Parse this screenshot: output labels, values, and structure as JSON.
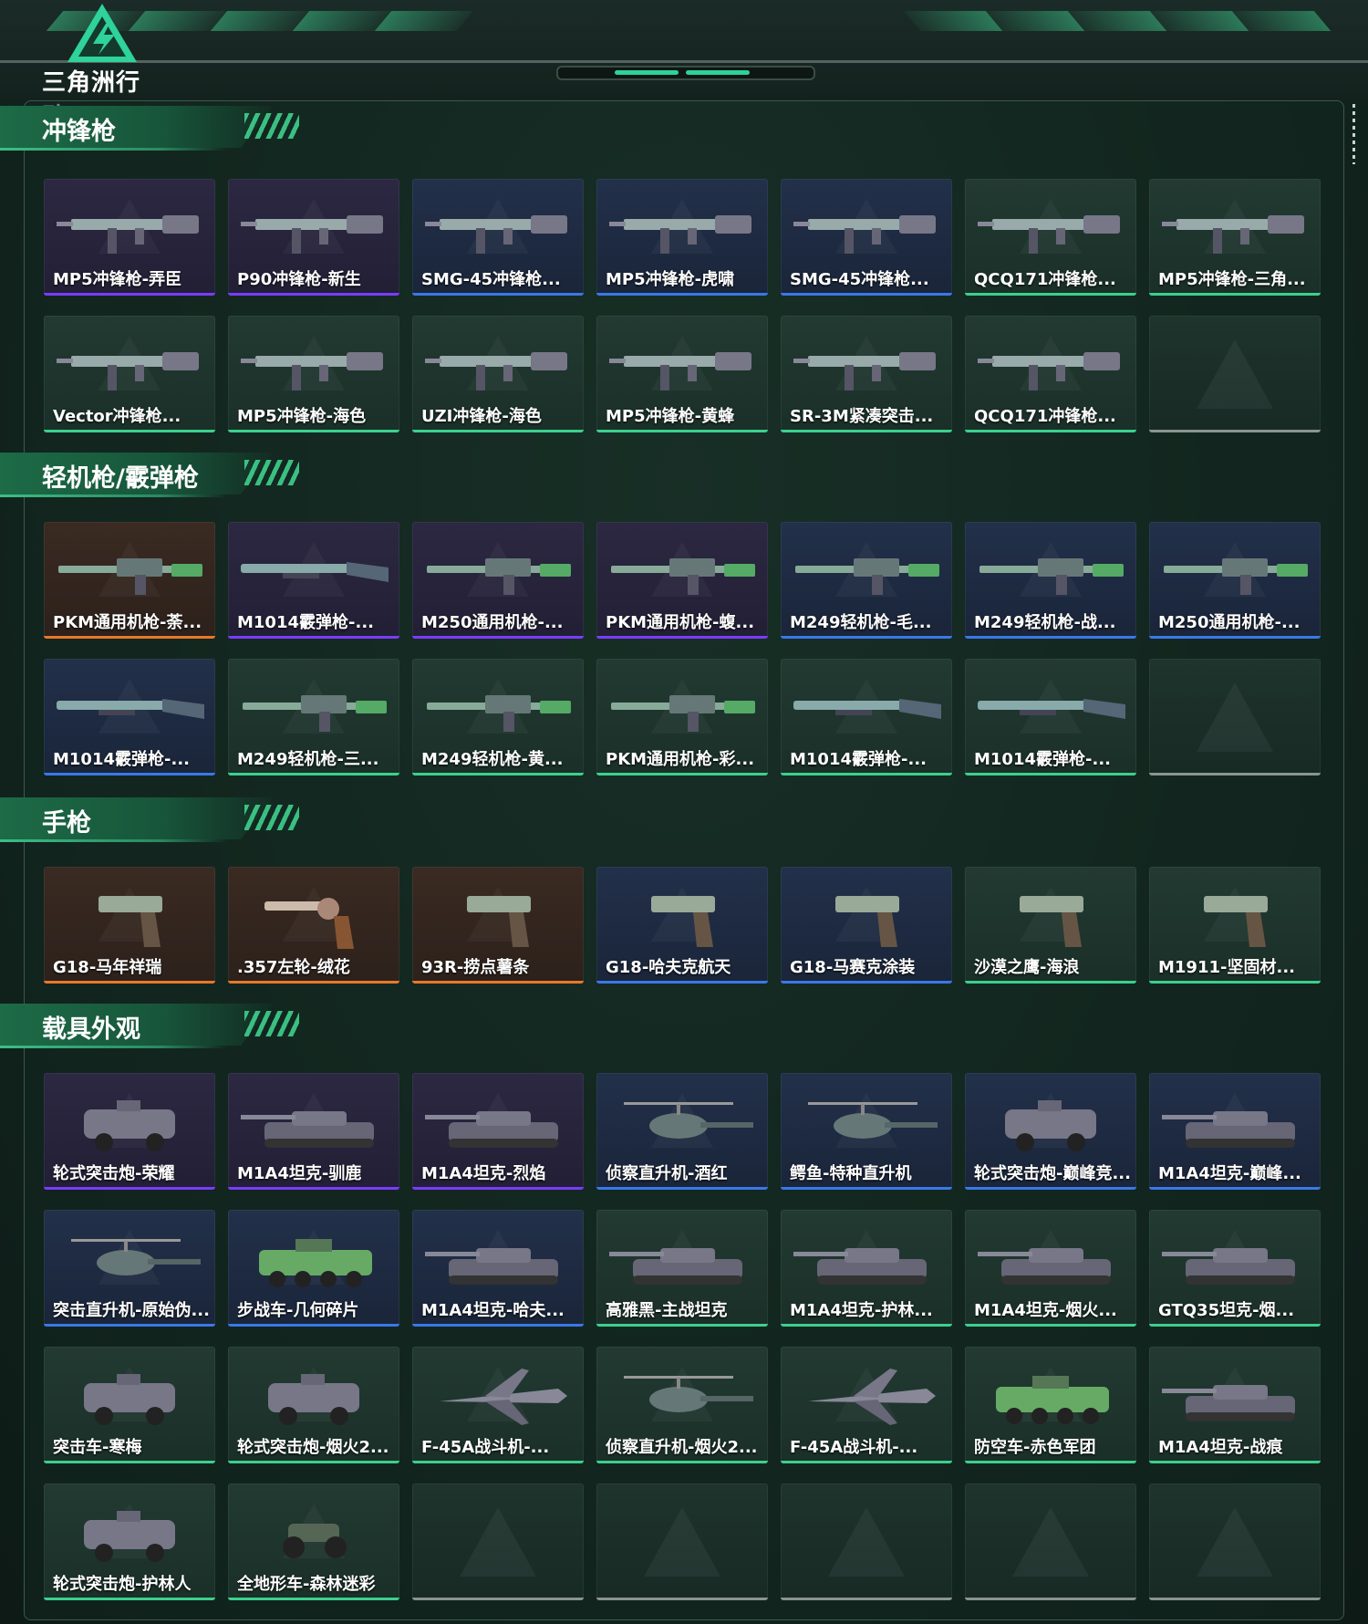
{
  "header": {
    "logo_text": "三角洲行动"
  },
  "colors": {
    "purple": "#7a3cff",
    "blue": "#3a78e8",
    "orange": "#e8782a",
    "green": "#3bd08f",
    "gray": "#8a9490"
  },
  "sections": [
    {
      "title": "冲锋枪",
      "rows": [
        [
          {
            "label": "MP5冲锋枪-弄臣",
            "rarity": "purple",
            "icon": "smg-icon"
          },
          {
            "label": "P90冲锋枪-新生",
            "rarity": "purple",
            "icon": "smg-icon"
          },
          {
            "label": "SMG-45冲锋枪...",
            "rarity": "blue",
            "icon": "smg-icon"
          },
          {
            "label": "MP5冲锋枪-虎啸",
            "rarity": "blue",
            "icon": "smg-icon"
          },
          {
            "label": "SMG-45冲锋枪...",
            "rarity": "blue",
            "icon": "smg-icon"
          },
          {
            "label": "QCQ171冲锋枪...",
            "rarity": "green",
            "icon": "smg-icon"
          },
          {
            "label": "MP5冲锋枪-三角...",
            "rarity": "green",
            "icon": "smg-icon"
          }
        ],
        [
          {
            "label": "Vector冲锋枪...",
            "rarity": "green",
            "icon": "smg-icon"
          },
          {
            "label": "MP5冲锋枪-海色",
            "rarity": "green",
            "icon": "smg-icon"
          },
          {
            "label": "UZI冲锋枪-海色",
            "rarity": "green",
            "icon": "smg-icon"
          },
          {
            "label": "MP5冲锋枪-黄蜂",
            "rarity": "green",
            "icon": "smg-icon"
          },
          {
            "label": "SR-3M紧凑突击...",
            "rarity": "green",
            "icon": "smg-icon"
          },
          {
            "label": "QCQ171冲锋枪...",
            "rarity": "green",
            "icon": "smg-icon"
          },
          {
            "label": "",
            "rarity": "gray",
            "icon": "empty-slot-icon"
          }
        ]
      ]
    },
    {
      "title": "轻机枪/霰弹枪",
      "rows": [
        [
          {
            "label": "PKM通用机枪-荼...",
            "rarity": "orange",
            "icon": "lmg-icon"
          },
          {
            "label": "M1014霰弹枪-...",
            "rarity": "purple",
            "icon": "shotgun-icon"
          },
          {
            "label": "M250通用机枪-...",
            "rarity": "purple",
            "icon": "lmg-icon"
          },
          {
            "label": "PKM通用机枪-蝮...",
            "rarity": "purple",
            "icon": "lmg-icon"
          },
          {
            "label": "M249轻机枪-毛...",
            "rarity": "blue",
            "icon": "lmg-icon"
          },
          {
            "label": "M249轻机枪-战...",
            "rarity": "blue",
            "icon": "lmg-icon"
          },
          {
            "label": "M250通用机枪-...",
            "rarity": "blue",
            "icon": "lmg-icon"
          }
        ],
        [
          {
            "label": "M1014霰弹枪-...",
            "rarity": "blue",
            "icon": "shotgun-icon"
          },
          {
            "label": "M249轻机枪-三...",
            "rarity": "green",
            "icon": "lmg-icon"
          },
          {
            "label": "M249轻机枪-黄...",
            "rarity": "green",
            "icon": "lmg-icon"
          },
          {
            "label": "PKM通用机枪-彩...",
            "rarity": "green",
            "icon": "lmg-icon"
          },
          {
            "label": "M1014霰弹枪-...",
            "rarity": "green",
            "icon": "shotgun-icon"
          },
          {
            "label": "M1014霰弹枪-...",
            "rarity": "green",
            "icon": "shotgun-icon"
          },
          {
            "label": "",
            "rarity": "gray",
            "icon": "empty-slot-icon"
          }
        ]
      ]
    },
    {
      "title": "手枪",
      "rows": [
        [
          {
            "label": "G18-马年祥瑞",
            "rarity": "orange",
            "icon": "pistol-icon"
          },
          {
            "label": ".357左轮-绒花",
            "rarity": "orange",
            "icon": "revolver-icon"
          },
          {
            "label": "93R-捞点薯条",
            "rarity": "orange",
            "icon": "pistol-icon"
          },
          {
            "label": "G18-哈夫克航天",
            "rarity": "blue",
            "icon": "pistol-icon"
          },
          {
            "label": "G18-马赛克涂装",
            "rarity": "blue",
            "icon": "pistol-icon"
          },
          {
            "label": "沙漠之鹰-海浪",
            "rarity": "green",
            "icon": "pistol-icon"
          },
          {
            "label": "M1911-坚固材...",
            "rarity": "green",
            "icon": "pistol-icon"
          }
        ]
      ]
    },
    {
      "title": "载具外观",
      "rows": [
        [
          {
            "label": "轮式突击炮-荣耀",
            "rarity": "purple",
            "icon": "armored-car-icon"
          },
          {
            "label": "M1A4坦克-驯鹿",
            "rarity": "purple",
            "icon": "tank-icon"
          },
          {
            "label": "M1A4坦克-烈焰",
            "rarity": "purple",
            "icon": "tank-icon"
          },
          {
            "label": "侦察直升机-酒红",
            "rarity": "blue",
            "icon": "helicopter-icon"
          },
          {
            "label": "鳄鱼-特种直升机",
            "rarity": "blue",
            "icon": "helicopter-icon"
          },
          {
            "label": "轮式突击炮-巅峰竞...",
            "rarity": "blue",
            "icon": "armored-car-icon"
          },
          {
            "label": "M1A4坦克-巅峰...",
            "rarity": "blue",
            "icon": "tank-icon"
          }
        ],
        [
          {
            "label": "突击直升机-原始伪...",
            "rarity": "blue",
            "icon": "helicopter-icon"
          },
          {
            "label": "步战车-几何碎片",
            "rarity": "blue",
            "icon": "ifv-icon"
          },
          {
            "label": "M1A4坦克-哈夫...",
            "rarity": "blue",
            "icon": "tank-icon"
          },
          {
            "label": "高雅黑-主战坦克",
            "rarity": "green",
            "icon": "tank-icon"
          },
          {
            "label": "M1A4坦克-护林...",
            "rarity": "green",
            "icon": "tank-icon"
          },
          {
            "label": "M1A4坦克-烟火...",
            "rarity": "green",
            "icon": "tank-icon"
          },
          {
            "label": "GTQ35坦克-烟...",
            "rarity": "green",
            "icon": "tank-icon"
          }
        ],
        [
          {
            "label": "突击车-寒梅",
            "rarity": "green",
            "icon": "armored-car-icon"
          },
          {
            "label": "轮式突击炮-烟火2...",
            "rarity": "green",
            "icon": "armored-car-icon"
          },
          {
            "label": "F-45A战斗机-...",
            "rarity": "green",
            "icon": "jet-icon"
          },
          {
            "label": "侦察直升机-烟火2...",
            "rarity": "green",
            "icon": "helicopter-icon"
          },
          {
            "label": "F-45A战斗机-...",
            "rarity": "green",
            "icon": "jet-icon"
          },
          {
            "label": "防空车-赤色军团",
            "rarity": "green",
            "icon": "ifv-icon"
          },
          {
            "label": "M1A4坦克-战痕",
            "rarity": "green",
            "icon": "tank-icon"
          }
        ],
        [
          {
            "label": "轮式突击炮-护林人",
            "rarity": "green",
            "icon": "armored-car-icon"
          },
          {
            "label": "全地形车-森林迷彩",
            "rarity": "green",
            "icon": "atv-icon"
          },
          {
            "label": "",
            "rarity": "gray",
            "icon": "empty-slot-icon"
          },
          {
            "label": "",
            "rarity": "gray",
            "icon": "empty-slot-icon"
          },
          {
            "label": "",
            "rarity": "gray",
            "icon": "empty-slot-icon"
          },
          {
            "label": "",
            "rarity": "gray",
            "icon": "empty-slot-icon"
          },
          {
            "label": "",
            "rarity": "gray",
            "icon": "empty-slot-icon"
          }
        ]
      ]
    }
  ]
}
